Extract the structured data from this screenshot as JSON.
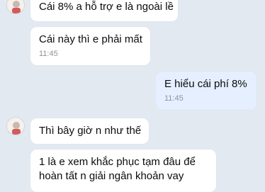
{
  "colors": {
    "background": "#e2e9f1",
    "incoming_bubble": "#ffffff",
    "outgoing_bubble": "#e5efff",
    "timestamp": "#8b929b"
  },
  "messages": [
    {
      "direction": "incoming",
      "text": "Cái 8% a hỗ trợ e là ngoài lề"
    },
    {
      "direction": "incoming",
      "text": "Cái này thì e phải mất",
      "time": "11:45"
    },
    {
      "direction": "outgoing",
      "text": "E hiểu cái phí 8%",
      "time": "11:45"
    },
    {
      "direction": "incoming",
      "text": "Thì bây giờ n như thế"
    },
    {
      "direction": "incoming",
      "text": "1 là e xem khắc phục tạm đâu để hoàn tất n giải ngân khoản vay"
    }
  ],
  "avatar": {
    "icon": "contact-avatar-icon"
  }
}
